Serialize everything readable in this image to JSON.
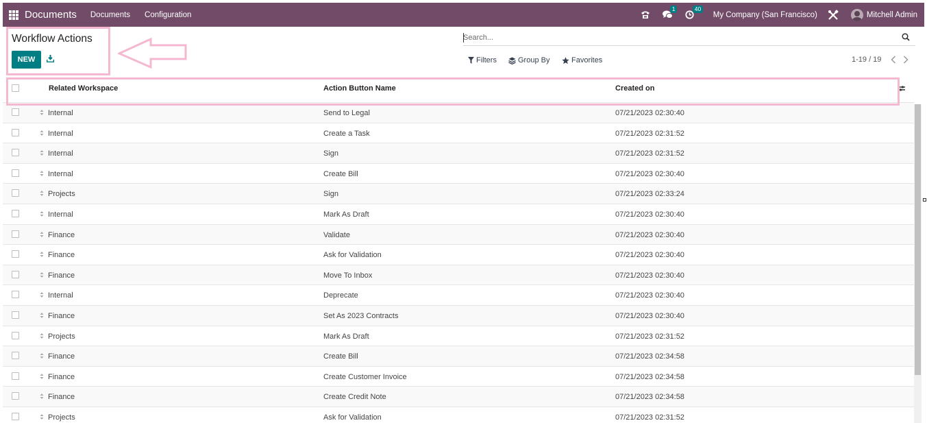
{
  "navbar": {
    "app_name": "Documents",
    "menu": [
      "Documents",
      "Configuration"
    ],
    "chat_count": "1",
    "activity_count": "40",
    "company": "My Company (San Francisco)",
    "user": "Mitchell Admin",
    "color": "#714b67"
  },
  "control_panel": {
    "title": "Workflow Actions",
    "new_label": "NEW",
    "search_placeholder": "Search...",
    "filters_label": "Filters",
    "group_by_label": "Group By",
    "favorites_label": "Favorites",
    "pager": "1-19 / 19",
    "accent_color": "#017e84"
  },
  "table": {
    "headers": [
      "Related Workspace",
      "Action Button Name",
      "Created on"
    ],
    "rows": [
      [
        "Internal",
        "Send to Legal",
        "07/21/2023 02:30:40"
      ],
      [
        "Internal",
        "Create a Task",
        "07/21/2023 02:31:52"
      ],
      [
        "Internal",
        "Sign",
        "07/21/2023 02:31:52"
      ],
      [
        "Internal",
        "Create Bill",
        "07/21/2023 02:30:40"
      ],
      [
        "Projects",
        "Sign",
        "07/21/2023 02:33:24"
      ],
      [
        "Internal",
        "Mark As Draft",
        "07/21/2023 02:30:40"
      ],
      [
        "Finance",
        "Validate",
        "07/21/2023 02:30:40"
      ],
      [
        "Finance",
        "Ask for Validation",
        "07/21/2023 02:30:40"
      ],
      [
        "Finance",
        "Move To Inbox",
        "07/21/2023 02:30:40"
      ],
      [
        "Internal",
        "Deprecate",
        "07/21/2023 02:30:40"
      ],
      [
        "Finance",
        "Set As 2023 Contracts",
        "07/21/2023 02:30:40"
      ],
      [
        "Projects",
        "Mark As Draft",
        "07/21/2023 02:31:52"
      ],
      [
        "Finance",
        "Create Bill",
        "07/21/2023 02:34:58"
      ],
      [
        "Finance",
        "Create Customer Invoice",
        "07/21/2023 02:34:58"
      ],
      [
        "Finance",
        "Create Credit Note",
        "07/21/2023 02:34:58"
      ],
      [
        "Projects",
        "Ask for Validation",
        "07/21/2023 02:31:52"
      ]
    ]
  },
  "annotation_color": "#f4b8d0",
  "icons": [
    "apps-grid-icon",
    "phone-icon",
    "chat-icon",
    "clock-icon",
    "tools-icon",
    "download-icon",
    "search-icon",
    "filter-icon",
    "layers-icon",
    "star-icon",
    "sort-handle-icon",
    "column-settings-icon"
  ]
}
